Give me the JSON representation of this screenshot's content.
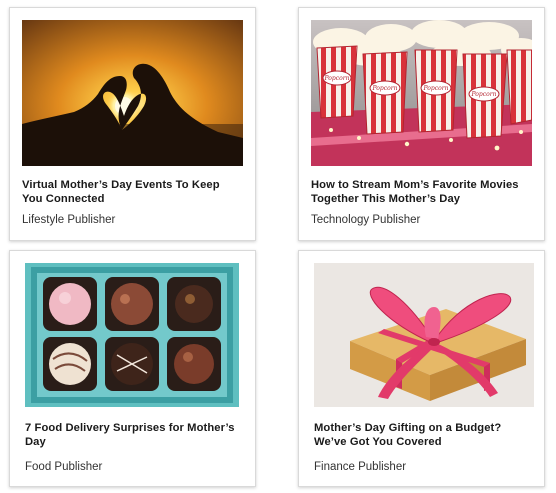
{
  "cards": [
    {
      "title": "Virtual Mother’s Day Events To Keep You Connected",
      "publisher": "Lifestyle Publisher",
      "image": "heart-hands-sunset"
    },
    {
      "title": "How to Stream Mom’s Favorite Movies Together This Mother’s Day",
      "publisher": "Technology Publisher",
      "image": "popcorn-boxes"
    },
    {
      "title": "7 Food Delivery Surprises for Mother’s Day",
      "publisher": "Food Publisher",
      "image": "chocolate-truffles-box"
    },
    {
      "title": "Mother’s Day Gifting on a Budget? We’ve Got You Covered",
      "publisher": "Finance Publisher",
      "image": "gift-box-pink-ribbon"
    }
  ],
  "popcorn_label": "Popcorn"
}
